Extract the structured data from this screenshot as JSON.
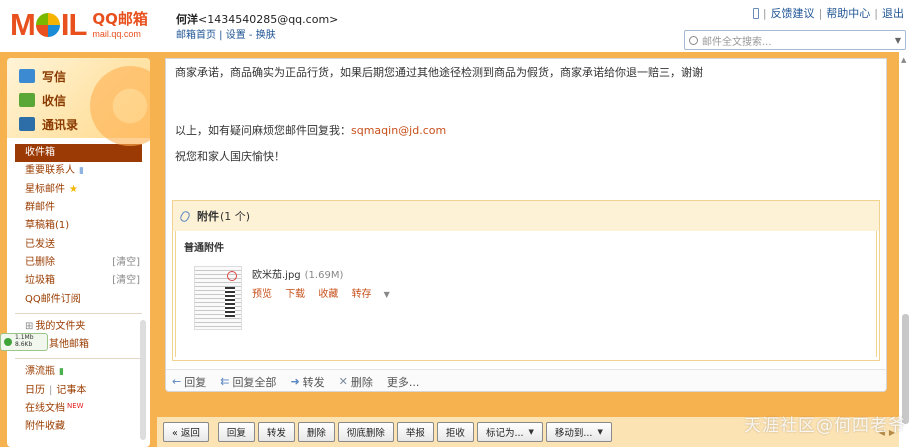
{
  "header": {
    "logo_text": "MOIL",
    "logo_qq": "QQ邮箱",
    "logo_domain": "mail.qq.com",
    "user_name": "何洋",
    "user_email": "<1434540285@qq.com>",
    "link_home": "邮箱首页",
    "link_sep": " | ",
    "link_settings": "设置",
    "link_dash": " - ",
    "link_skin": "换肤",
    "feedback": "反馈建议",
    "help": "帮助中心",
    "logout": "退出",
    "search_placeholder": "邮件全文搜索..."
  },
  "sidebar": {
    "write": "写信",
    "receive": "收信",
    "contacts": "通讯录",
    "items": [
      {
        "label": "收件箱"
      },
      {
        "label": "重要联系人"
      },
      {
        "label": "星标邮件"
      },
      {
        "label": "群邮件"
      },
      {
        "label": "草稿箱(1)"
      },
      {
        "label": "已发送"
      },
      {
        "label": "已删除",
        "action": "[清空]"
      },
      {
        "label": "垃圾箱",
        "action": "[清空]"
      },
      {
        "label": "QQ邮件订阅"
      }
    ],
    "folders": "我的文件夹",
    "other_mail": "其他邮箱",
    "items2": [
      {
        "label": "漂流瓶"
      },
      {
        "label": "日历",
        "extra": "记事本"
      },
      {
        "label": "在线文档",
        "badge": "NEW"
      },
      {
        "label": "附件收藏"
      }
    ],
    "net_up": "1.1Mb",
    "net_down": "8.6Kb"
  },
  "mail": {
    "line1": "商家承诺，商品确实为正品行货，如果后期您通过其他途径检测到商品为假货，商家承诺给你退一赔三，谢谢",
    "line2_prefix": "以上，如有疑问麻烦您邮件回复我：",
    "line2_email": "sqmaqin@jd.com",
    "line3": "祝您和家人国庆愉快！"
  },
  "attachment": {
    "title": "附件",
    "count": "(1 个)",
    "type_label": "普通附件",
    "file_name": "欧米茄.jpg",
    "file_size": "(1.69M)",
    "actions": [
      "预览",
      "下载",
      "收藏",
      "转存"
    ]
  },
  "action_bar": {
    "reply": "回复",
    "reply_all": "回复全部",
    "forward": "转发",
    "delete": "删除",
    "more": "更多..."
  },
  "bottom_bar": {
    "back": "« 返回",
    "reply": "回复",
    "forward": "转发",
    "delete": "删除",
    "perm_delete": "彻底删除",
    "report": "举报",
    "reject": "拒收",
    "mark_as": "标记为...",
    "move_to": "移动到..."
  },
  "watermark": "天涯社区@何四老爷"
}
